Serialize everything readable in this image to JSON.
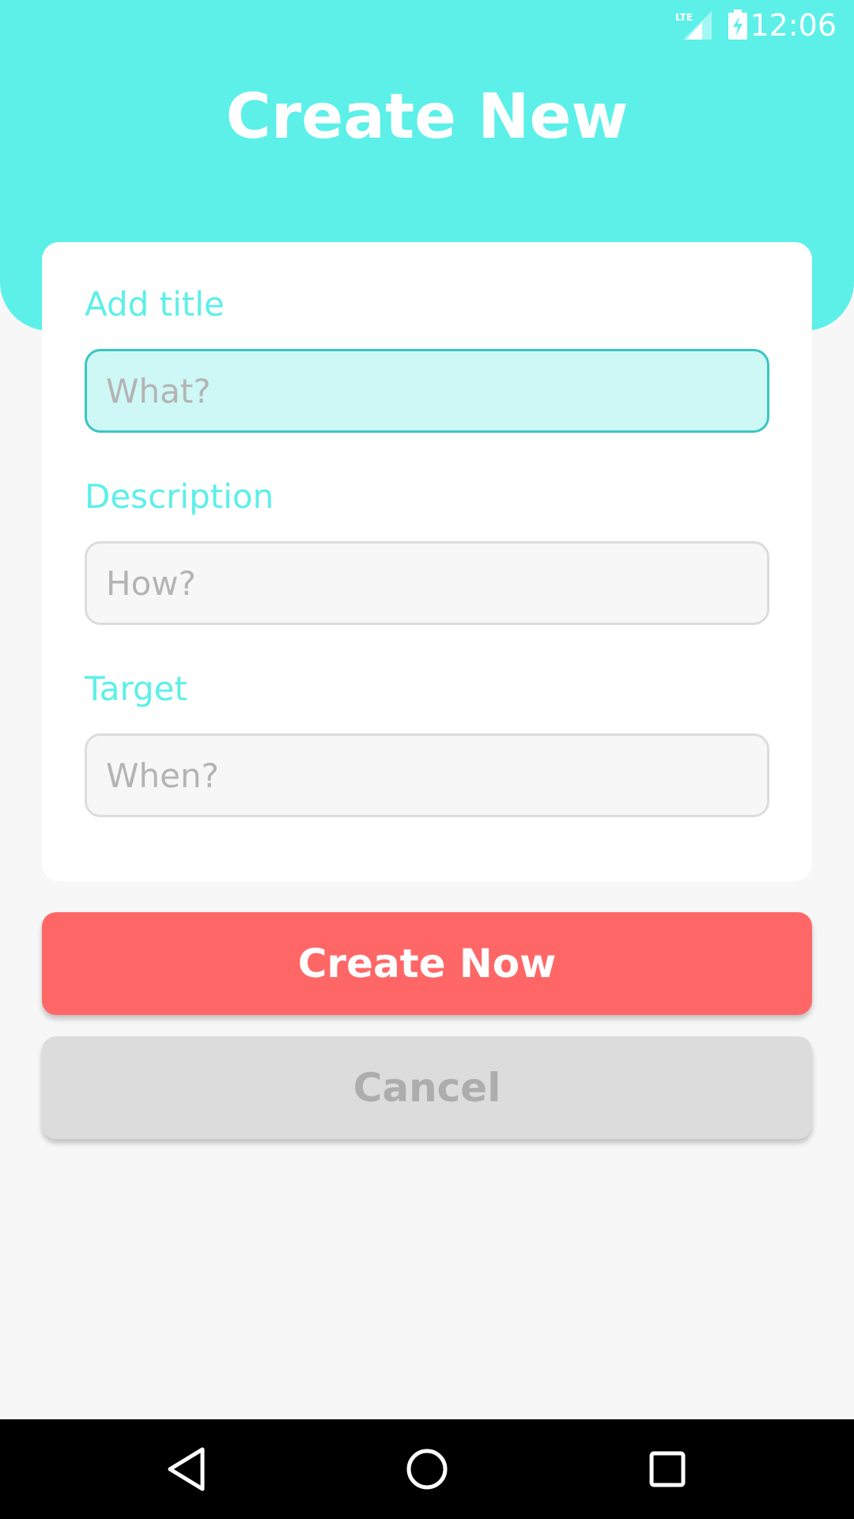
{
  "status_bar": {
    "network": "LTE",
    "time": "12:06",
    "network_icon": "lte-signal-icon",
    "battery_icon": "battery-charging-icon"
  },
  "header": {
    "title": "Create New",
    "color": "#5cf0e9"
  },
  "form": {
    "fields": [
      {
        "label": "Add title",
        "placeholder": "What?",
        "value": ""
      },
      {
        "label": "Description",
        "placeholder": "How?",
        "value": ""
      },
      {
        "label": "Target",
        "placeholder": "When?",
        "value": ""
      }
    ]
  },
  "actions": {
    "create_label": "Create Now",
    "create_color": "#ff6767",
    "cancel_label": "Cancel",
    "cancel_color": "#dcdcdc"
  },
  "nav_bar": {
    "back_icon": "back-triangle-icon",
    "home_icon": "home-circle-icon",
    "recents_icon": "recents-square-icon"
  }
}
